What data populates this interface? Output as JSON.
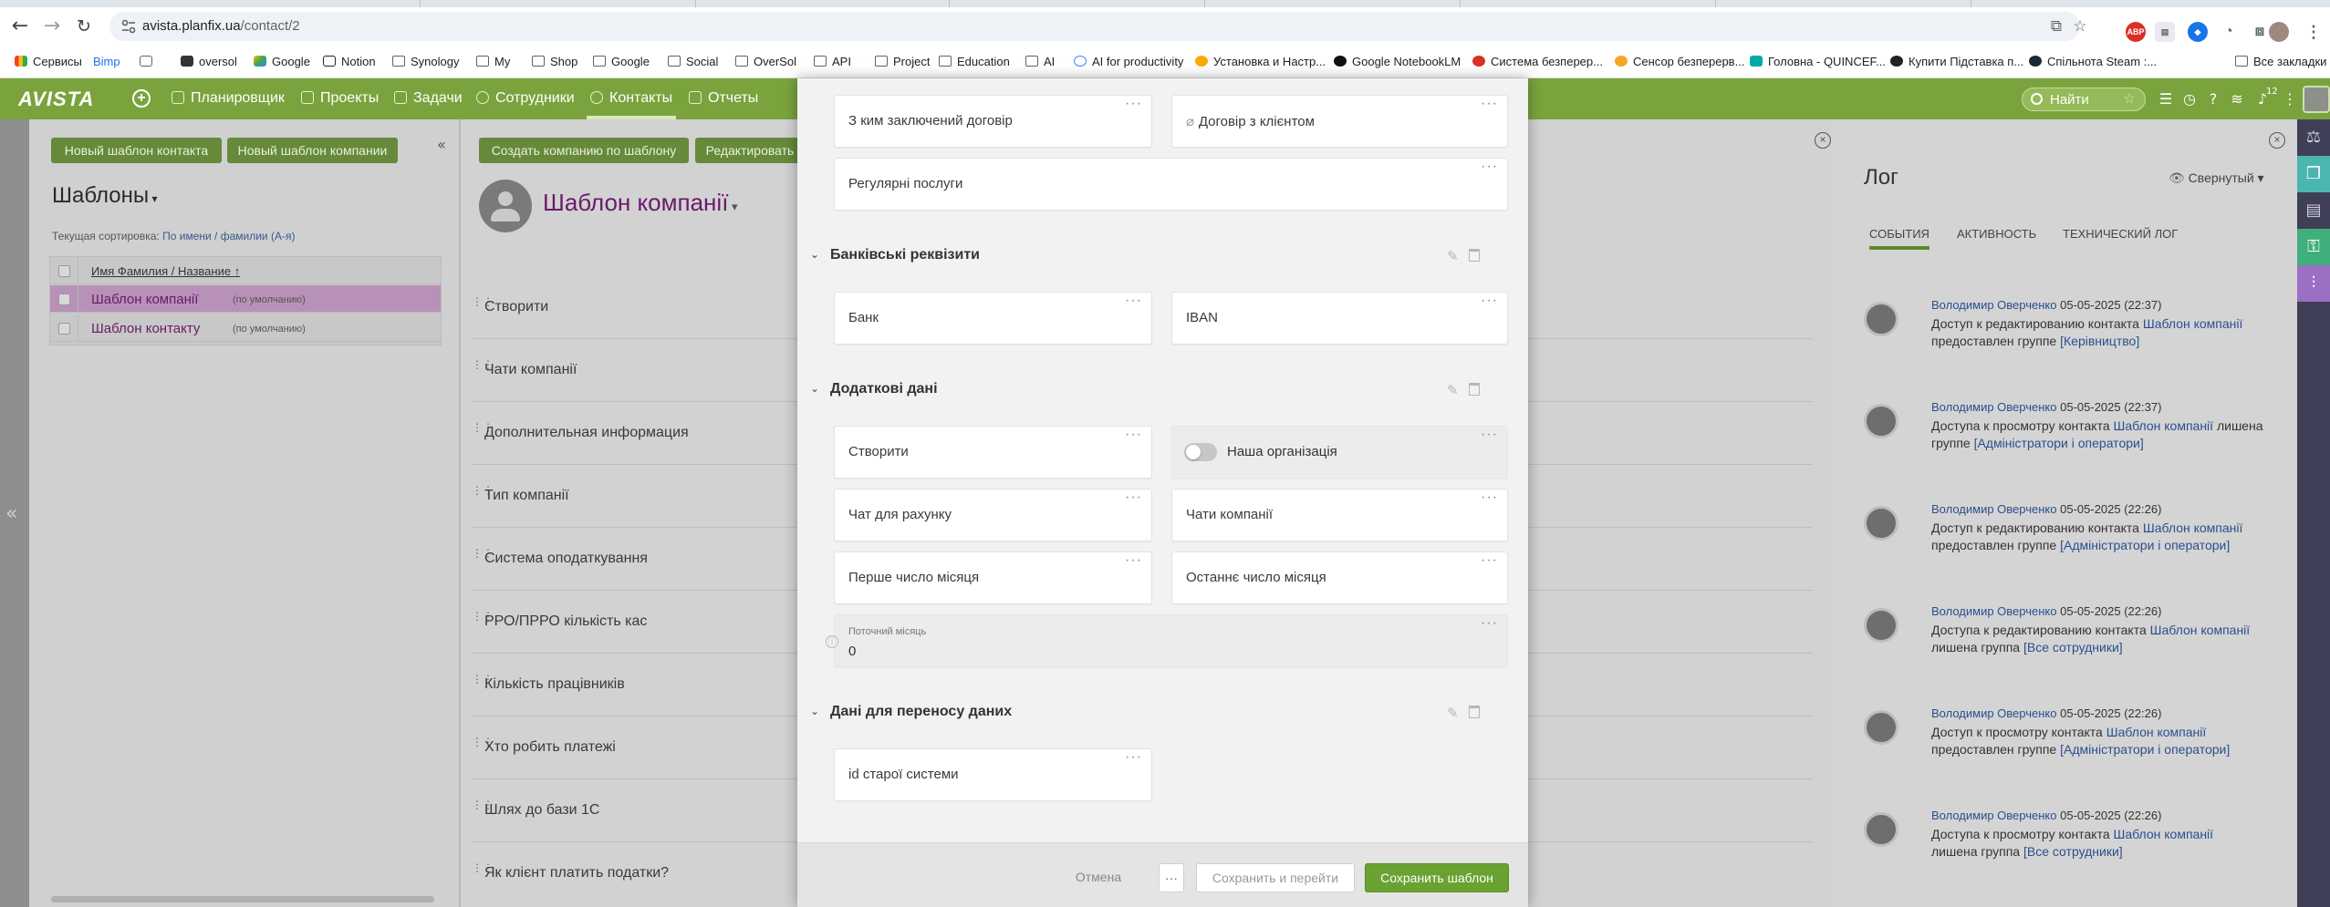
{
  "browser": {
    "url_host": "avista.planfix.ua",
    "url_path": "/contact/2",
    "bookmarks": [
      "Сервисы",
      "Bimp",
      "oversol",
      "Google",
      "Notion",
      "Synology",
      "My",
      "Shop",
      "Google",
      "Social",
      "OverSol",
      "API",
      "Project",
      "Education",
      "AI",
      "AI for productivity",
      "Установка и Настр...",
      "Google NotebookLM",
      "Система безперер...",
      "Сенсор безперерв...",
      "Головна - QUINCEF...",
      "Купити Підставка п...",
      "Спільнота Steam :...",
      "Все закладки"
    ],
    "extensions": [
      "ABP"
    ]
  },
  "app": {
    "logo": "AVISTA",
    "nav": [
      "Планировщик",
      "Проекты",
      "Задачи",
      "Сотрудники",
      "Контакты",
      "Отчеты"
    ],
    "active_nav": "Контакты",
    "search_placeholder": "Найти",
    "counter": "12"
  },
  "left_panel": {
    "buttons": [
      "Новый шаблон контакта",
      "Новый шаблон компании"
    ],
    "title": "Шаблоны",
    "sort_label": "Текущая сортировка:",
    "sort_value": "По имени / фамилии (А-я)",
    "column_header": "Имя Фамилия / Название",
    "rows": [
      {
        "name": "Шаблон компанії",
        "note": "(по умолчанию)"
      },
      {
        "name": "Шаблон контакту",
        "note": "(по умолчанию)"
      }
    ]
  },
  "main_panel": {
    "buttons": [
      "Создать компанию по шаблону",
      "Редактировать"
    ],
    "title": "Шаблон компанії",
    "fields": [
      "Створити",
      "Чати компанії",
      "Дополнительная информация",
      "Тип компанії",
      "Система оподаткування",
      "РРО/ПРРО кількість кас",
      "Кількість працівників",
      "Хто робить платежі",
      "Шлях до бази 1С",
      "Як клієнт платить податки?"
    ]
  },
  "log_panel": {
    "title": "Лог",
    "mode": "Свернутый",
    "tabs": [
      "СОБЫТИЯ",
      "АКТИВНОСТЬ",
      "ТЕХНИЧЕСКИЙ ЛОГ"
    ],
    "entries": [
      {
        "author": "Володимир Оверченко",
        "time": "05-05-2025 (22:37)",
        "line1_pre": "Доступ к редактированию контакта ",
        "line1_link": "Шаблон компанії",
        "line2_pre": "предоставлен группе ",
        "line2_link": "[Керівництво]",
        "line2_post": ""
      },
      {
        "author": "Володимир Оверченко",
        "time": "05-05-2025 (22:37)",
        "line1_pre": "Доступа к просмотру контакта ",
        "line1_link": "Шаблон компанії",
        "line2_pre": "группе ",
        "line2_link": "[Адміністратори і оператори]",
        "line2_post": "",
        "line1_post": " лишена"
      },
      {
        "author": "Володимир Оверченко",
        "time": "05-05-2025 (22:26)",
        "line1_pre": "Доступ к редактированию контакта ",
        "line1_link": "Шаблон компанії",
        "line2_pre": "предоставлен группе ",
        "line2_link": "[Адміністратори і оператори]",
        "line2_post": ""
      },
      {
        "author": "Володимир Оверченко",
        "time": "05-05-2025 (22:26)",
        "line1_pre": "Доступа к редактированию контакта ",
        "line1_link": "Шаблон компанії",
        "line2_pre": "лишена группа ",
        "line2_link": "[Все сотрудники]",
        "line2_post": ""
      },
      {
        "author": "Володимир Оверченко",
        "time": "05-05-2025 (22:26)",
        "line1_pre": "Доступ к просмотру контакта ",
        "line1_link": "Шаблон компанії",
        "line2_pre": "предоставлен группе ",
        "line2_link": "[Адміністратори і оператори]",
        "line2_post": ""
      },
      {
        "author": "Володимир Оверченко",
        "time": "05-05-2025 (22:26)",
        "line1_pre": "Доступа к просмотру контакта ",
        "line1_link": "Шаблон компанії",
        "line2_pre": "лишена группа ",
        "line2_link": "[Все сотрудники]",
        "line2_post": ""
      }
    ]
  },
  "modal": {
    "top_cards": {
      "c1": "З ким заключений договір",
      "c2": "Договір з клієнтом",
      "c3": "Регулярні послуги"
    },
    "sec_bank": {
      "title": "Банківські реквізити",
      "f1": "Банк",
      "f2": "IBAN"
    },
    "sec_extra": {
      "title": "Додаткові дані",
      "f1": "Створити",
      "f2": "Наша організація",
      "f3": "Чат для рахунку",
      "f4": "Чати компанії",
      "f5": "Перше число місяця",
      "f6": "Останнє число місяця",
      "current_month_label": "Поточний місяць",
      "current_month_value": "0"
    },
    "sec_transfer": {
      "title": "Дані для переносу даних",
      "f1": "id старої системи"
    },
    "footer": {
      "cancel": "Отмена",
      "more": "···",
      "save_go": "Сохранить и перейти",
      "save": "Сохранить шаблон"
    }
  },
  "colors": {
    "app_green": "#7aa33e",
    "primary_button": "#6aa232",
    "link": "#2a4f8f",
    "template_title": "#6b1a6b"
  }
}
